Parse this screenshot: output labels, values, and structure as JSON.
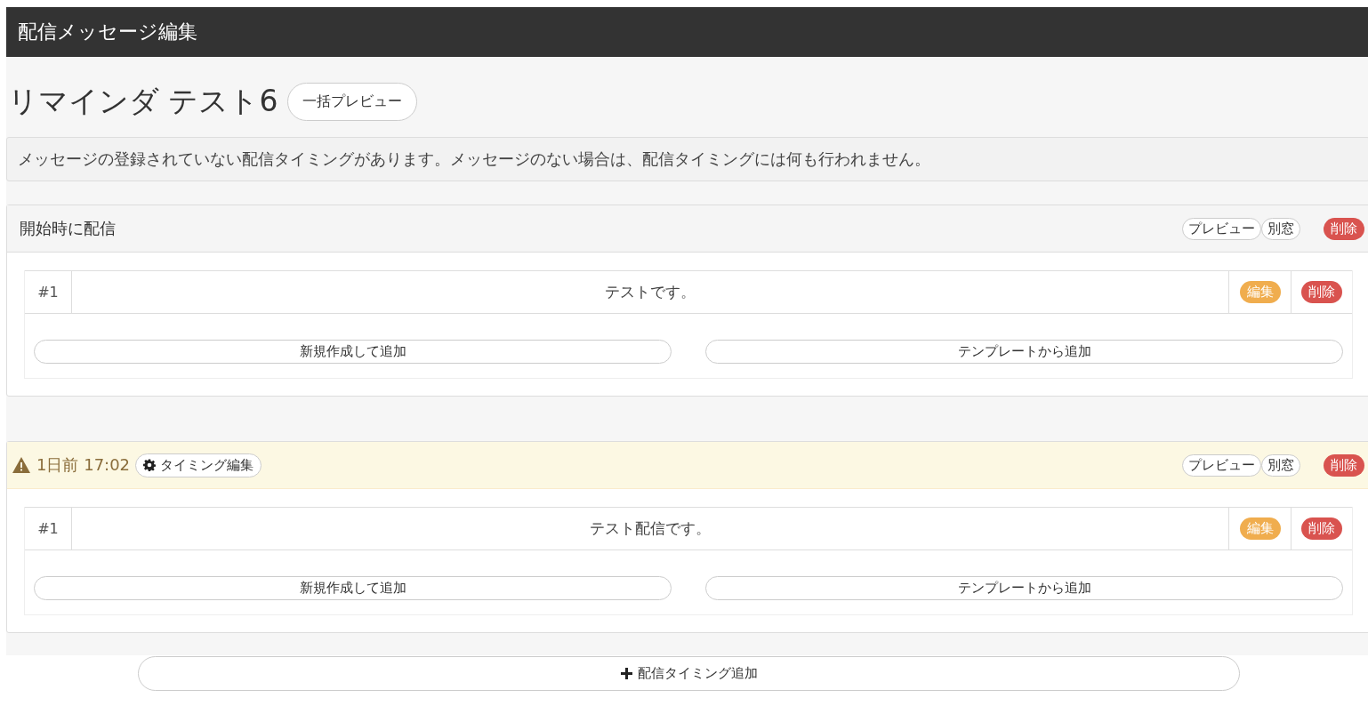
{
  "header": {
    "title": "配信メッセージ編集"
  },
  "page": {
    "title": "リマインダ テスト6",
    "preview_all_button": "一括プレビュー"
  },
  "notice": "メッセージの登録されていない配信タイミングがあります。メッセージのない場合は、配信タイミングには何も行われません。",
  "sections": [
    {
      "kind": "plain",
      "title": "開始時に配信",
      "preview_button": "プレビュー",
      "window_button": "別窓",
      "delete_button": "削除",
      "messages": [
        {
          "number": "#1",
          "text": "テストです。",
          "edit_button": "編集",
          "delete_button": "削除"
        }
      ],
      "add_new_button": "新規作成して追加",
      "add_template_button": "テンプレートから追加"
    },
    {
      "kind": "warning",
      "title": "1日前 17:02",
      "timing_button": "タイミング編集",
      "preview_button": "プレビュー",
      "window_button": "別窓",
      "delete_button": "削除",
      "messages": [
        {
          "number": "#1",
          "text": "テスト配信です。",
          "edit_button": "編集",
          "delete_button": "削除"
        }
      ],
      "add_new_button": "新規作成して追加",
      "add_template_button": "テンプレートから追加"
    }
  ],
  "add_timing_button": "配信タイミング追加"
}
